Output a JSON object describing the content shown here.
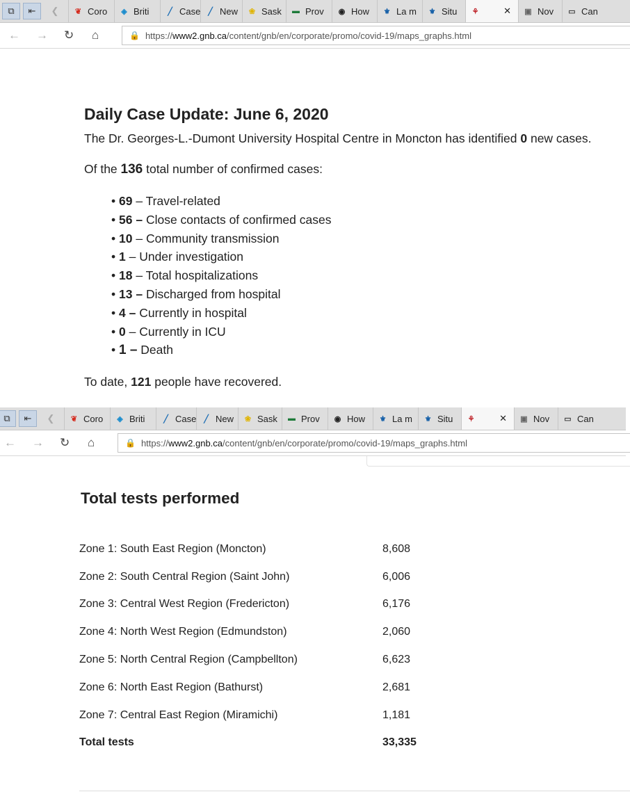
{
  "browser": {
    "tabs": [
      {
        "label": "Coro",
        "favicon": "maple-leaf-icon",
        "color": "#d52b1e"
      },
      {
        "label": "Briti",
        "favicon": "bc-logo-icon",
        "color": "#1a8ccd"
      },
      {
        "label": "Case",
        "favicon": "chart-icon",
        "color": "#1f6fb5"
      },
      {
        "label": "New",
        "favicon": "chart-icon",
        "color": "#1f6fb5"
      },
      {
        "label": "Sask",
        "favicon": "sask-icon",
        "color": "#e0b400"
      },
      {
        "label": "Prov",
        "favicon": "prov-icon",
        "color": "#1e7b3a"
      },
      {
        "label": "How",
        "favicon": "shield-icon",
        "color": "#222222"
      },
      {
        "label": "La m",
        "favicon": "fleur-de-lis-icon",
        "color": "#1660a8"
      },
      {
        "label": "Situ",
        "favicon": "fleur-de-lis-icon",
        "color": "#1660a8"
      },
      {
        "label": "",
        "favicon": "gnb-logo-icon",
        "color": "#c0272d",
        "active": true
      },
      {
        "label": "Nov",
        "favicon": "image-icon",
        "color": "#666666"
      },
      {
        "label": "Can",
        "favicon": "window-icon",
        "color": "#444444"
      }
    ],
    "url_scheme": "https://",
    "url_domain": "www2.gnb.ca",
    "url_path": "/content/gnb/en/corporate/promo/covid-19/maps_graphs.html"
  },
  "daily": {
    "title": "Daily Case Update: June 6, 2020",
    "intro_pre": "The Dr. Georges-L.-Dumont University Hospital Centre in Moncton has identified ",
    "intro_num": "0",
    "intro_post": " new cases.",
    "total_pre": "Of the ",
    "total_num": "136",
    "total_post": " total number of confirmed cases:",
    "items": [
      {
        "num": "69",
        "sep": " – ",
        "label": "Travel-related"
      },
      {
        "num": "56 –",
        "sep": " ",
        "label": "Close contacts of confirmed cases"
      },
      {
        "num": "10",
        "sep": " – ",
        "label": "Community transmission"
      },
      {
        "num": "1",
        "sep": " – ",
        "label": "Under investigation"
      },
      {
        "num": "18",
        "sep": " – ",
        "label": "Total hospitalizations"
      },
      {
        "num": "13 –",
        "sep": " ",
        "label": "Discharged from hospital"
      },
      {
        "num": "4 –",
        "sep": " ",
        "label": "Currently in hospital"
      },
      {
        "num": "0",
        "sep": " – ",
        "label": "Currently in ICU"
      },
      {
        "num": "1 –",
        "sep": " ",
        "label": "Death"
      }
    ],
    "recovered_pre": "To date, ",
    "recovered_num": "121",
    "recovered_post": " people have recovered."
  },
  "tests": {
    "title": "Total tests performed",
    "rows": [
      {
        "zone": "Zone 1: South East Region (Moncton)",
        "value": "8,608"
      },
      {
        "zone": "Zone 2: South Central Region (Saint John)",
        "value": "6,006"
      },
      {
        "zone": "Zone 3: Central West Region (Fredericton)",
        "value": "6,176"
      },
      {
        "zone": "Zone 4: North West Region (Edmundston)",
        "value": "2,060"
      },
      {
        "zone": "Zone 5: North Central Region (Campbellton)",
        "value": "6,623"
      },
      {
        "zone": "Zone 6: North East Region (Bathurst)",
        "value": "2,681"
      },
      {
        "zone": "Zone 7: Central East Region (Miramichi)",
        "value": "1,181"
      }
    ],
    "total_label": "Total tests",
    "total_value": "33,335"
  }
}
